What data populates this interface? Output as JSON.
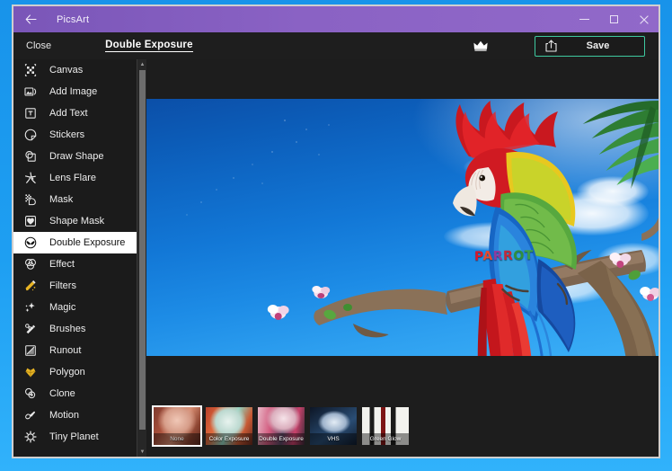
{
  "window": {
    "app_title": "PicsArt",
    "back_icon": "back-arrow-icon",
    "minimize_label": "–",
    "maximize_label": "□",
    "close_label": "×",
    "titlebar_color": "#8a62c4"
  },
  "toolbar": {
    "close_label": "Close",
    "tool_title": "Double Exposure",
    "crown_icon": "crown-icon",
    "share_icon": "share-export-icon",
    "save_label": "Save",
    "save_border_color": "#3ec9a0"
  },
  "sidebar": {
    "selected": "Double Exposure",
    "items": [
      {
        "label": "Canvas",
        "icon": "canvas-icon"
      },
      {
        "label": "Add Image",
        "icon": "add-image-icon"
      },
      {
        "label": "Add Text",
        "icon": "add-text-icon"
      },
      {
        "label": "Stickers",
        "icon": "stickers-icon"
      },
      {
        "label": "Draw Shape",
        "icon": "draw-shape-icon"
      },
      {
        "label": "Lens Flare",
        "icon": "lens-flare-icon"
      },
      {
        "label": "Mask",
        "icon": "mask-icon"
      },
      {
        "label": "Shape Mask",
        "icon": "shape-mask-icon"
      },
      {
        "label": "Double Exposure",
        "icon": "double-exposure-icon"
      },
      {
        "label": "Effect",
        "icon": "effect-icon"
      },
      {
        "label": "Filters",
        "icon": "filters-icon"
      },
      {
        "label": "Magic",
        "icon": "magic-icon"
      },
      {
        "label": "Brushes",
        "icon": "brushes-icon"
      },
      {
        "label": "Runout",
        "icon": "runout-icon"
      },
      {
        "label": "Polygon",
        "icon": "polygon-icon"
      },
      {
        "label": "Clone",
        "icon": "clone-icon"
      },
      {
        "label": "Motion",
        "icon": "motion-icon"
      },
      {
        "label": "Tiny Planet",
        "icon": "tiny-planet-icon"
      }
    ]
  },
  "canvas": {
    "overlay_text": "PARROT",
    "overlay_letters": [
      "P",
      "A",
      "R",
      "R",
      "O",
      "T"
    ],
    "sky_color": "#1277d6"
  },
  "filmstrip": {
    "selected_index": 0,
    "thumbnails": [
      {
        "label": "None",
        "art": "art-none"
      },
      {
        "label": "Color Exposure",
        "art": "art-color-exposure"
      },
      {
        "label": "Double Exposure",
        "art": "art-double-exposure"
      },
      {
        "label": "VHS",
        "art": "art-vhs"
      },
      {
        "label": "Green Glow",
        "art": "art-green-glow"
      }
    ]
  }
}
